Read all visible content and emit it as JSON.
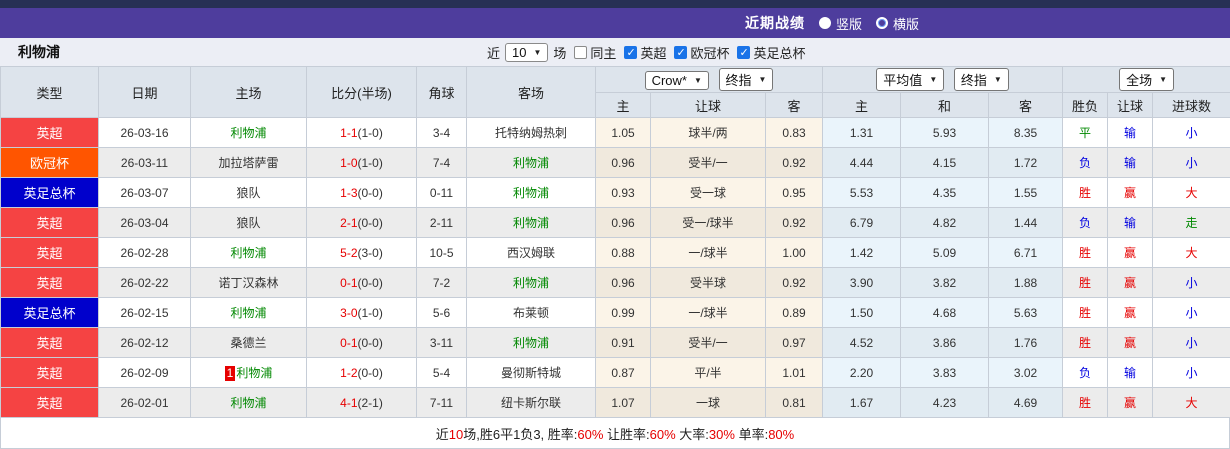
{
  "title_bar": {
    "title": "近期战绩",
    "radios": [
      {
        "label": "竖版",
        "selected": true
      },
      {
        "label": "横版",
        "selected": false
      }
    ]
  },
  "filter": {
    "team": "利物浦",
    "near_label": "近",
    "count_select": "10",
    "games_label": "场",
    "same_home": {
      "label": "同主",
      "checked": false
    },
    "leagues": [
      {
        "label": "英超",
        "checked": true
      },
      {
        "label": "欧冠杯",
        "checked": true
      },
      {
        "label": "英足总杯",
        "checked": true
      }
    ]
  },
  "table": {
    "headers": {
      "type": "类型",
      "date": "日期",
      "home": "主场",
      "score": "比分(半场)",
      "corner": "角球",
      "away": "客场",
      "sub": [
        "主",
        "让球",
        "客",
        "主",
        "和",
        "客",
        "胜负",
        "让球",
        "进球数"
      ]
    },
    "dropdowns": {
      "company": "Crow*",
      "final1": "终指",
      "average": "平均值",
      "final2": "终指",
      "fullmatch": "全场"
    },
    "league_colors": {
      "英超": "#f54343",
      "欧冠杯": "#ff5500",
      "英足总杯": "#0000cc"
    },
    "result_colors": {
      "r": "#e60000",
      "g": "#008800",
      "b": "#0000e0"
    },
    "rows": [
      {
        "league": "英超",
        "date": "26-03-16",
        "home": "利物浦",
        "home_focus": true,
        "home_badge": "",
        "score_ft": "1-1",
        "score_ht": "(1-0)",
        "corner": "3-4",
        "away": "托特纳姆热刺",
        "away_focus": false,
        "asian": [
          "1.05",
          "球半/两",
          "0.83"
        ],
        "euro": [
          "1.31",
          "5.93",
          "8.35"
        ],
        "results": [
          [
            "平",
            "g"
          ],
          [
            "输",
            "b"
          ],
          [
            "小",
            "b"
          ]
        ]
      },
      {
        "league": "欧冠杯",
        "date": "26-03-11",
        "home": "加拉塔萨雷",
        "home_focus": false,
        "home_badge": "",
        "score_ft": "1-0",
        "score_ht": "(1-0)",
        "corner": "7-4",
        "away": "利物浦",
        "away_focus": true,
        "asian": [
          "0.96",
          "受半/一",
          "0.92"
        ],
        "euro": [
          "4.44",
          "4.15",
          "1.72"
        ],
        "results": [
          [
            "负",
            "b"
          ],
          [
            "输",
            "b"
          ],
          [
            "小",
            "b"
          ]
        ]
      },
      {
        "league": "英足总杯",
        "date": "26-03-07",
        "home": "狼队",
        "home_focus": false,
        "home_badge": "",
        "score_ft": "1-3",
        "score_ht": "(0-0)",
        "corner": "0-11",
        "away": "利物浦",
        "away_focus": true,
        "asian": [
          "0.93",
          "受一球",
          "0.95"
        ],
        "euro": [
          "5.53",
          "4.35",
          "1.55"
        ],
        "results": [
          [
            "胜",
            "r"
          ],
          [
            "赢",
            "r"
          ],
          [
            "大",
            "r"
          ]
        ]
      },
      {
        "league": "英超",
        "date": "26-03-04",
        "home": "狼队",
        "home_focus": false,
        "home_badge": "",
        "score_ft": "2-1",
        "score_ht": "(0-0)",
        "corner": "2-11",
        "away": "利物浦",
        "away_focus": true,
        "asian": [
          "0.96",
          "受一/球半",
          "0.92"
        ],
        "euro": [
          "6.79",
          "4.82",
          "1.44"
        ],
        "results": [
          [
            "负",
            "b"
          ],
          [
            "输",
            "b"
          ],
          [
            "走",
            "g"
          ]
        ]
      },
      {
        "league": "英超",
        "date": "26-02-28",
        "home": "利物浦",
        "home_focus": true,
        "home_badge": "",
        "score_ft": "5-2",
        "score_ht": "(3-0)",
        "corner": "10-5",
        "away": "西汉姆联",
        "away_focus": false,
        "asian": [
          "0.88",
          "一/球半",
          "1.00"
        ],
        "euro": [
          "1.42",
          "5.09",
          "6.71"
        ],
        "results": [
          [
            "胜",
            "r"
          ],
          [
            "赢",
            "r"
          ],
          [
            "大",
            "r"
          ]
        ]
      },
      {
        "league": "英超",
        "date": "26-02-22",
        "home": "诺丁汉森林",
        "home_focus": false,
        "home_badge": "",
        "score_ft": "0-1",
        "score_ht": "(0-0)",
        "corner": "7-2",
        "away": "利物浦",
        "away_focus": true,
        "asian": [
          "0.96",
          "受半球",
          "0.92"
        ],
        "euro": [
          "3.90",
          "3.82",
          "1.88"
        ],
        "results": [
          [
            "胜",
            "r"
          ],
          [
            "赢",
            "r"
          ],
          [
            "小",
            "b"
          ]
        ]
      },
      {
        "league": "英足总杯",
        "date": "26-02-15",
        "home": "利物浦",
        "home_focus": true,
        "home_badge": "",
        "score_ft": "3-0",
        "score_ht": "(1-0)",
        "corner": "5-6",
        "away": "布莱顿",
        "away_focus": false,
        "asian": [
          "0.99",
          "一/球半",
          "0.89"
        ],
        "euro": [
          "1.50",
          "4.68",
          "5.63"
        ],
        "results": [
          [
            "胜",
            "r"
          ],
          [
            "赢",
            "r"
          ],
          [
            "小",
            "b"
          ]
        ]
      },
      {
        "league": "英超",
        "date": "26-02-12",
        "home": "桑德兰",
        "home_focus": false,
        "home_badge": "",
        "score_ft": "0-1",
        "score_ht": "(0-0)",
        "corner": "3-11",
        "away": "利物浦",
        "away_focus": true,
        "asian": [
          "0.91",
          "受半/一",
          "0.97"
        ],
        "euro": [
          "4.52",
          "3.86",
          "1.76"
        ],
        "results": [
          [
            "胜",
            "r"
          ],
          [
            "赢",
            "r"
          ],
          [
            "小",
            "b"
          ]
        ]
      },
      {
        "league": "英超",
        "date": "26-02-09",
        "home": "利物浦",
        "home_focus": true,
        "home_badge": "1",
        "score_ft": "1-2",
        "score_ht": "(0-0)",
        "corner": "5-4",
        "away": "曼彻斯特城",
        "away_focus": false,
        "asian": [
          "0.87",
          "平/半",
          "1.01"
        ],
        "euro": [
          "2.20",
          "3.83",
          "3.02"
        ],
        "results": [
          [
            "负",
            "b"
          ],
          [
            "输",
            "b"
          ],
          [
            "小",
            "b"
          ]
        ]
      },
      {
        "league": "英超",
        "date": "26-02-01",
        "home": "利物浦",
        "home_focus": true,
        "home_badge": "",
        "score_ft": "4-1",
        "score_ht": "(2-1)",
        "corner": "7-11",
        "away": "纽卡斯尔联",
        "away_focus": false,
        "asian": [
          "1.07",
          "一球",
          "0.81"
        ],
        "euro": [
          "1.67",
          "4.23",
          "4.69"
        ],
        "results": [
          [
            "胜",
            "r"
          ],
          [
            "赢",
            "r"
          ],
          [
            "大",
            "r"
          ]
        ]
      }
    ]
  },
  "summary": {
    "parts": [
      {
        "text": "近",
        "red": false
      },
      {
        "text": "10",
        "red": true
      },
      {
        "text": "场,胜6平1负3, 胜率:",
        "red": false
      },
      {
        "text": "60%",
        "red": true
      },
      {
        "text": " 让胜率:",
        "red": false
      },
      {
        "text": "60%",
        "red": true
      },
      {
        "text": " 大率:",
        "red": false
      },
      {
        "text": "30%",
        "red": true
      },
      {
        "text": " 单率:",
        "red": false
      },
      {
        "text": "80%",
        "red": true
      }
    ]
  }
}
